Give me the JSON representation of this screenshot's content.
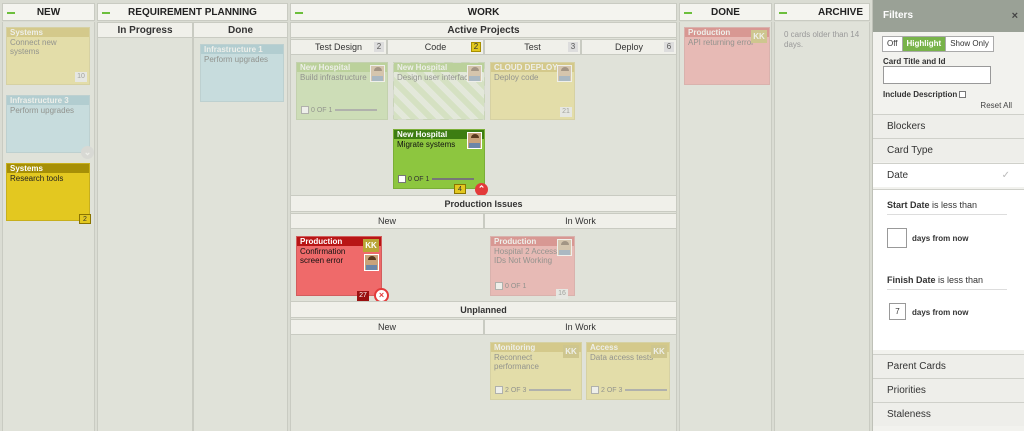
{
  "lanes": {
    "new": "NEW",
    "req": "REQUIREMENT PLANNING",
    "work": "WORK",
    "done": "DONE",
    "archive": "ARCHIVE"
  },
  "req_cols": {
    "in_progress": "In Progress",
    "done": "Done"
  },
  "active_projects": "Active Projects",
  "work_cols": [
    {
      "label": "Test Design",
      "count": "2"
    },
    {
      "label": "Code",
      "count": "2"
    },
    {
      "label": "Test",
      "count": "3"
    },
    {
      "label": "Deploy",
      "count": "6"
    }
  ],
  "production_issues": "Production Issues",
  "pi_cols": {
    "new": "New",
    "in_work": "In Work"
  },
  "unplanned": "Unplanned",
  "up_cols": {
    "new": "New",
    "in_work": "In Work"
  },
  "new_cards": [
    {
      "type": "Systems",
      "title": "Connect new systems",
      "count": "10"
    },
    {
      "type": "Infrastructure 3",
      "title": "Perform upgrades"
    },
    {
      "type": "Systems",
      "title": "Research tools",
      "count": "2"
    }
  ],
  "req_cards": [
    {
      "type": "Infrastructure 1",
      "title": "Perform upgrades"
    }
  ],
  "active_cards": [
    {
      "type": "New Hospital",
      "title": "Build infrastructure",
      "progress": "0 OF 1"
    },
    {
      "type": "New Hospital",
      "title": "Design user interface"
    },
    {
      "type": "CLOUD DEPLOY",
      "title": "Deploy code",
      "count": "21"
    },
    {
      "type": "New Hospital",
      "title": "Migrate systems",
      "progress": "0 OF 1",
      "count": "4"
    }
  ],
  "pi_cards": [
    {
      "type": "Production",
      "title": "Confirmation screen error",
      "initials": "KK",
      "count": "27"
    },
    {
      "type": "Production",
      "title": "Hospital 2 Access IDs Not Working",
      "progress": "0 OF 1",
      "count": "16"
    }
  ],
  "up_cards": [
    {
      "type": "Monitoring",
      "title": "Reconnect performance",
      "progress": "2 OF 3",
      "initials": "KK"
    },
    {
      "type": "Access",
      "title": "Data access tests",
      "progress": "2 OF 3",
      "initials": "KK"
    }
  ],
  "done_cards": [
    {
      "type": "Production",
      "title": "API returning error",
      "initials": "KK"
    }
  ],
  "archive_text": "0 cards older than 14 days.",
  "filters": {
    "title": "Filters",
    "close": "×",
    "modes": [
      "Off",
      "Highlight",
      "Show Only"
    ],
    "card_title_label": "Card Title and Id",
    "include_desc": "Include Description",
    "reset": "Reset All",
    "rows_top": [
      "Blockers",
      "Card Type",
      "Date"
    ],
    "start_date_bold": "Start Date",
    "start_date_rest": " is less than",
    "start_suffix": "days from now",
    "finish_date_bold": "Finish Date",
    "finish_date_rest": " is less than",
    "finish_value": "7",
    "finish_suffix": "days from now",
    "rows_bottom": [
      "Parent Cards",
      "Priorities",
      "Staleness"
    ]
  },
  "colors": {
    "accent": "#78b34a",
    "yellow": "#e2c81d",
    "red": "#ef6a6a",
    "blue": "#b5dbe6",
    "green": "#8dc63f"
  }
}
